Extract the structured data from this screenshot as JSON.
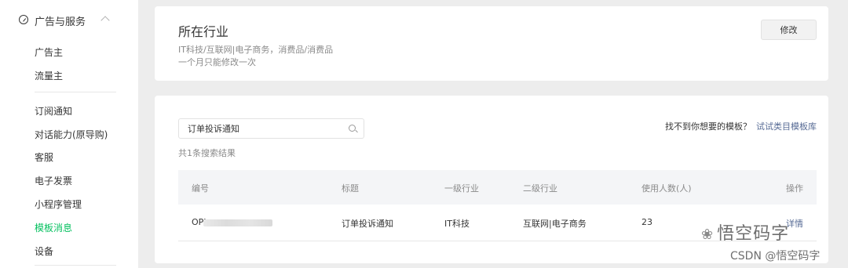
{
  "sidebar": {
    "group_label": "广告与服务",
    "items_top": [
      "广告主",
      "流量主"
    ],
    "items": [
      "订阅通知",
      "对话能力(原导购)",
      "客服",
      "电子发票",
      "小程序管理",
      "模板消息",
      "设备"
    ],
    "active_item": "模板消息"
  },
  "industry": {
    "title": "所在行业",
    "value": "IT科技/互联网|电子商务，消费品/消费品",
    "note": "一个月只能修改一次",
    "edit_label": "修改"
  },
  "search": {
    "value": "订单投诉通知",
    "result_count": "共1条搜索结果",
    "not_found": "找不到你想要的模板？",
    "try_link": "试试类目模板库"
  },
  "table": {
    "columns": [
      "编号",
      "标题",
      "一级行业",
      "二级行业",
      "使用人数(人)",
      "操作"
    ],
    "rows": [
      {
        "id": "OPI",
        "title": "订单投诉通知",
        "industry1": "IT科技",
        "industry2": "互联网|电子商务",
        "users": "23",
        "action": "详情"
      }
    ]
  },
  "watermark": {
    "line1": "悟空码字",
    "line2": "CSDN @悟空码字"
  },
  "colors": {
    "accent": "#07c160",
    "link": "#576b95"
  }
}
